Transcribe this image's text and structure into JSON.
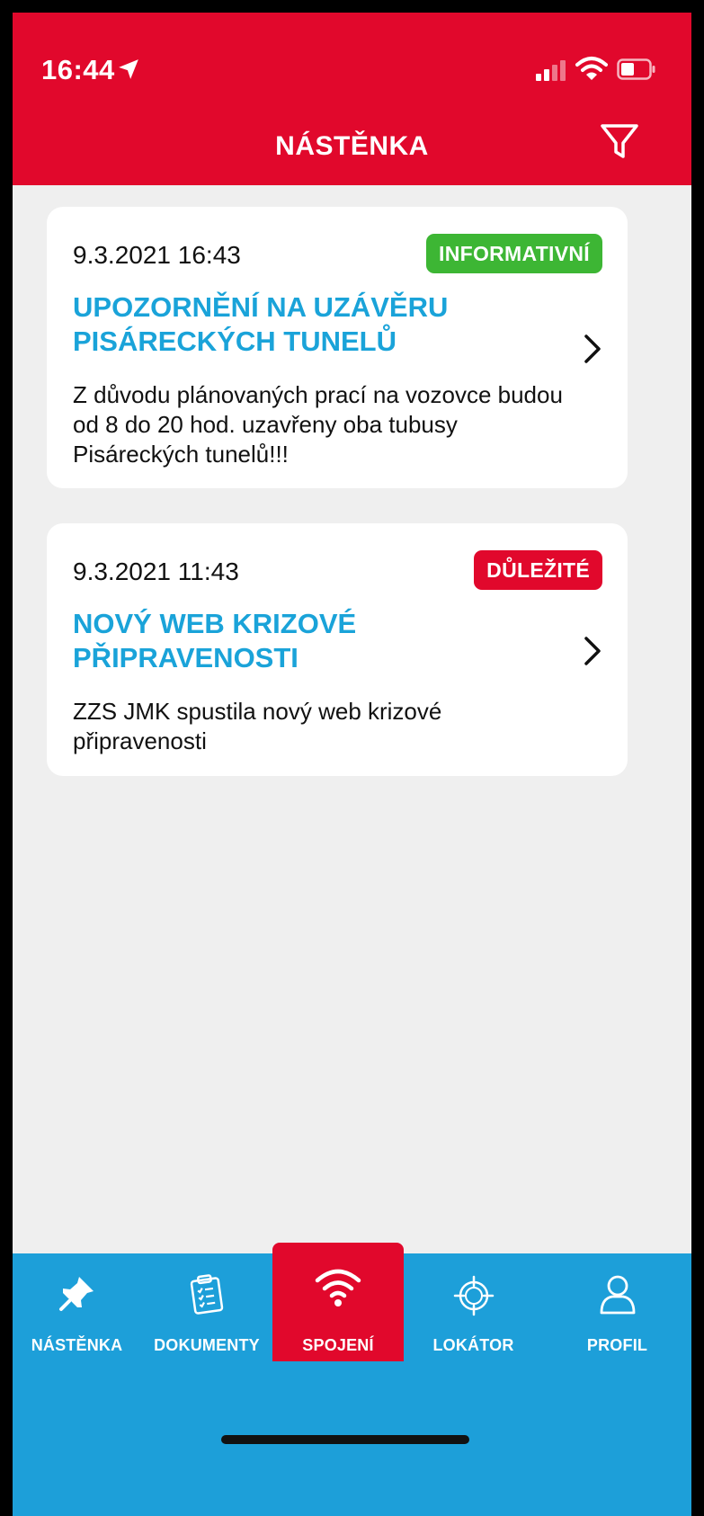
{
  "status_bar": {
    "time": "16:44"
  },
  "header": {
    "title": "NÁSTĚNKA"
  },
  "cards": [
    {
      "date": "9.3.2021 16:43",
      "badge": "INFORMATIVNÍ",
      "title": "UPOZORNĚNÍ NA UZÁVĚRU PISÁRECKÝCH TUNELŮ",
      "text": "Z důvodu plánovaných prací na vozovce budou od 8 do 20 hod. uzavřeny oba tubusy Pisáreckých tunelů!!!"
    },
    {
      "date": "9.3.2021 11:43",
      "badge": "DŮLEŽITÉ",
      "title": "NOVÝ WEB KRIZOVÉ PŘIPRAVENOSTI",
      "text": "ZZS JMK spustila nový web krizové připravenosti"
    }
  ],
  "bottom_nav": {
    "items": [
      {
        "label": "NÁSTĚNKA",
        "icon": "pin-icon"
      },
      {
        "label": "DOKUMENTY",
        "icon": "clipboard-icon"
      },
      {
        "label": "SPOJENÍ",
        "icon": "wifi-icon",
        "active": true
      },
      {
        "label": "LOKÁTOR",
        "icon": "crosshair-icon"
      },
      {
        "label": "PROFIL",
        "icon": "user-icon"
      }
    ]
  },
  "colors": {
    "header": "#e1082c",
    "nav": "#1d9fd9",
    "title": "#1aa3d9",
    "badge_info": "#3db634",
    "badge_important": "#e1082c"
  }
}
